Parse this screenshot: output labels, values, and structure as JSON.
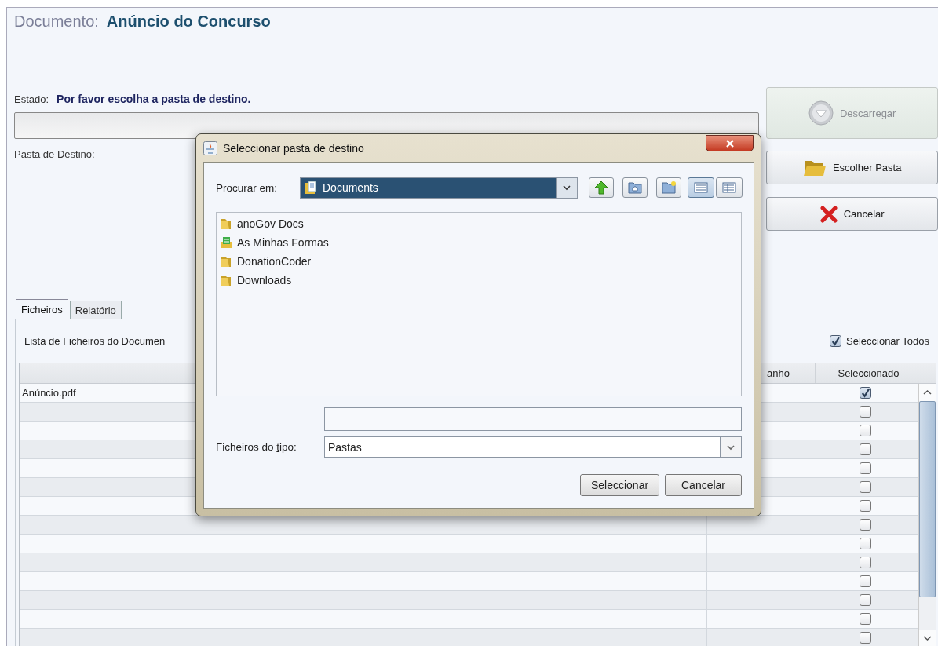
{
  "header": {
    "label": "Documento:",
    "title": "Anúncio do Concurso"
  },
  "status": {
    "label": "Estado:",
    "message": "Por favor escolha a pasta de destino."
  },
  "progress": {
    "level": 0
  },
  "destination": {
    "label": "Pasta de Destino:"
  },
  "actions": [
    {
      "label": "Descarregar",
      "kind": "download",
      "disabled": true
    },
    {
      "label": "Escolher Pasta",
      "kind": "folder",
      "disabled": false
    },
    {
      "label": "Cancelar",
      "kind": "cancel",
      "disabled": false
    }
  ],
  "tabs": [
    {
      "label": "Ficheiros",
      "selected": true
    },
    {
      "label": "Relatório",
      "selected": false
    }
  ],
  "files_panel": {
    "caption": "Lista de Ficheiros do Documen",
    "select_all": {
      "label": "Seleccionar Todos",
      "checked": true
    }
  },
  "table": {
    "column_2_header": "anho",
    "selected_header": "Seleccionado",
    "rows": [
      {
        "name": "Anúncio.pdf",
        "selected": true
      },
      {
        "selected": false
      },
      {
        "selected": false
      },
      {
        "selected": false
      },
      {
        "selected": false
      },
      {
        "selected": false
      },
      {
        "selected": false
      },
      {
        "selected": false
      },
      {
        "selected": false
      },
      {
        "selected": false
      },
      {
        "selected": false
      },
      {
        "selected": false
      },
      {
        "selected": false
      },
      {
        "selected": false
      }
    ]
  },
  "dialog": {
    "title": "Seleccionar pasta de destino",
    "look_in_label": "Procurar em:",
    "look_in_value": "Documents",
    "view_modes": [
      {
        "kind": "list",
        "selected": true
      },
      {
        "kind": "details",
        "selected": false
      }
    ],
    "items": [
      {
        "name": "anoGov Docs",
        "kind": "folder"
      },
      {
        "name": "As Minhas Formas",
        "kind": "forms"
      },
      {
        "name": "DonationCoder",
        "kind": "folder"
      },
      {
        "name": "Downloads",
        "kind": "folder"
      }
    ],
    "type_label": {
      "before": "Ficheiros do ",
      "underlined": "t",
      "after": "ipo:"
    },
    "type_value": "Pastas",
    "buttons": [
      {
        "label": "Seleccionar"
      },
      {
        "label": "Cancelar"
      }
    ]
  }
}
